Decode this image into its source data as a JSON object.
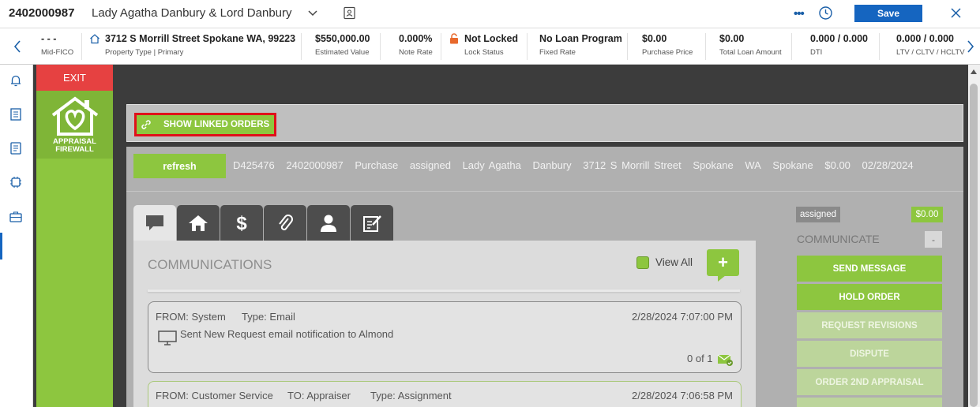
{
  "header": {
    "loan_number": "2402000987",
    "borrower": "Lady Agatha Danbury & Lord Danbury",
    "more_label": "•••",
    "save_label": "Save"
  },
  "infobar": {
    "cells": [
      {
        "value": "- - -",
        "label": "Mid-FICO"
      },
      {
        "value": "3712 S Morrill Street Spokane WA, 99223",
        "label": "Property Type | Primary"
      },
      {
        "value": "$550,000.00",
        "label": "Estimated Value"
      },
      {
        "value": "0.000%",
        "label": "Note Rate"
      },
      {
        "value": "Not Locked",
        "label": "Lock Status"
      },
      {
        "value": "No Loan Program",
        "label": "Fixed Rate"
      },
      {
        "value": "$0.00",
        "label": "Purchase Price"
      },
      {
        "value": "$0.00",
        "label": "Total Loan Amount"
      },
      {
        "value": "0.000 / 0.000",
        "label": "DTI"
      },
      {
        "value": "0.000 / 0.000",
        "label": "LTV / CLTV / HCLTV"
      }
    ]
  },
  "app": {
    "exit_label": "EXIT",
    "logo_line1": "APPRAISAL",
    "logo_line2": "FIREWALL",
    "linked_orders_label": "SHOW LINKED ORDERS",
    "refresh_label": "refresh",
    "order_fields": [
      "D425476",
      "2402000987",
      "Purchase",
      "assigned",
      "Lady Agatha",
      "Danbury",
      "3712 S Morrill Street",
      "Spokane",
      "WA",
      "Spokane",
      "$0.00",
      "02/28/2024"
    ],
    "communications_title": "COMMUNICATIONS",
    "view_all_label": "View All",
    "add_label": "+",
    "messages": [
      {
        "from": "FROM: System",
        "to": "",
        "type": "Type: Email",
        "datetime": "2/28/2024 7:07:00 PM",
        "body": "Sent New Request email notification to Almond",
        "count": "0 of 1"
      },
      {
        "from": "FROM: Customer Service",
        "to": "TO: Appraiser",
        "type": "Type: Assignment",
        "datetime": "2/28/2024 7:06:58 PM",
        "body": "",
        "count": ""
      }
    ],
    "right_panel": {
      "status": "assigned",
      "amount": "$0.00",
      "communicate_label": "COMMUNICATE",
      "collapse_label": "-",
      "buttons": [
        {
          "label": "SEND MESSAGE",
          "enabled": true
        },
        {
          "label": "HOLD ORDER",
          "enabled": true
        },
        {
          "label": "REQUEST REVISIONS",
          "enabled": false
        },
        {
          "label": "DISPUTE",
          "enabled": false
        },
        {
          "label": "ORDER 2ND APPRAISAL",
          "enabled": false
        }
      ]
    }
  },
  "colors": {
    "accent_green": "#8dc63f",
    "exit_red": "#e64141",
    "save_blue": "#1565c0",
    "highlight_red": "#e0101a"
  }
}
